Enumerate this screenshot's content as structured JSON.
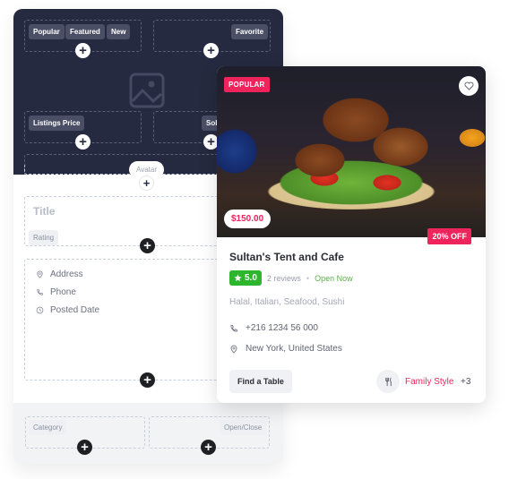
{
  "builder": {
    "top_chips": [
      "Popular",
      "Featured",
      "New"
    ],
    "favorite_chip": "Favorite",
    "price_chip": "Listings Price",
    "sold_chip": "Sold",
    "avatar_label": "Avatar",
    "title_placeholder": "Title",
    "rating_chip": "Rating",
    "meta_fields": [
      {
        "icon": "map-pin-icon",
        "label": "Address"
      },
      {
        "icon": "phone-icon",
        "label": "Phone"
      },
      {
        "icon": "clock-icon",
        "label": "Posted Date"
      }
    ],
    "category_chip": "Category",
    "open_close_chip": "Open/Close",
    "add_symbol": "+"
  },
  "card": {
    "badge": "POPULAR",
    "price": "$150.00",
    "discount": "20% OFF",
    "title": "Sultan's Tent and Cafe",
    "rating": "5.0",
    "reviews": "2 reviews",
    "separator": "•",
    "status": "Open Now",
    "cuisines": "Halal, Italian, Seafood, Sushi",
    "phone": "+216 1234 56 000",
    "location": "New York, United States",
    "cta": "Find a Table",
    "category": "Family Style",
    "category_more": "+3",
    "colors": {
      "accent": "#f0245c",
      "rating": "#2db52d",
      "open": "#5db04a",
      "dark_panel": "#262a40"
    }
  }
}
